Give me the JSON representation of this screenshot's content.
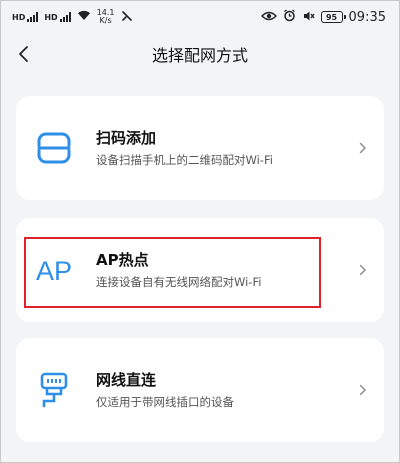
{
  "status_bar": {
    "sim1_tag": "HD",
    "sim2_tag": "HD",
    "speed_value": "14.1",
    "speed_unit": "K/s",
    "battery": "95",
    "time": "09:35"
  },
  "header": {
    "title": "选择配网方式"
  },
  "options": [
    {
      "icon": "scan-frame-icon",
      "title": "扫码添加",
      "subtitle": "设备扫描手机上的二维码配对Wi-Fi"
    },
    {
      "icon": "ap-text-icon",
      "icon_text": "AP",
      "title": "AP热点",
      "subtitle": "连接设备自有无线网络配对Wi-Fi"
    },
    {
      "icon": "ethernet-port-icon",
      "title": "网线直连",
      "subtitle": "仅适用于带网线插口的设备"
    }
  ],
  "colors": {
    "accent": "#2f8fe6",
    "highlight": "#e0222a",
    "background": "#f3f4f6",
    "card": "#ffffff"
  }
}
